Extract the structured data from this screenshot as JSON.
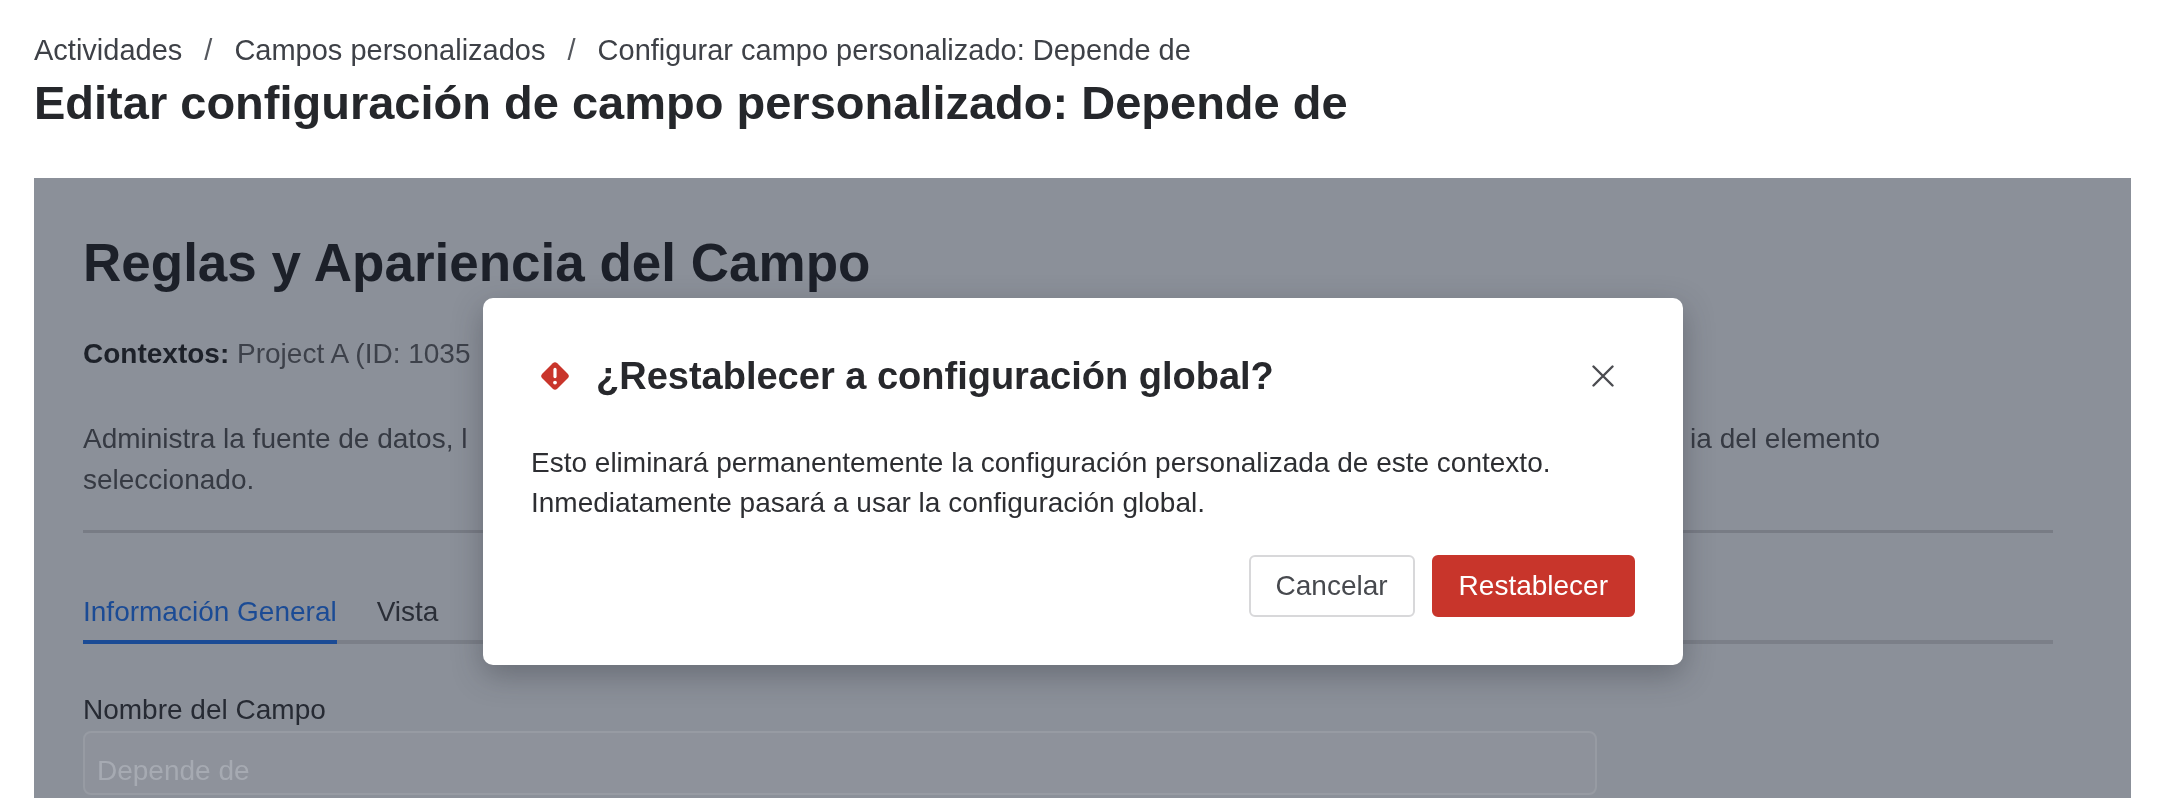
{
  "breadcrumb": [
    {
      "label": "Actividades"
    },
    {
      "separator": "/",
      "label": "Campos personalizados"
    },
    {
      "separator": "/",
      "label": "Configurar campo personalizado: Depende de"
    }
  ],
  "page_title": "Editar configuración de campo personalizado: Depende de",
  "card": {
    "title": "Reglas y Apariencia del Campo",
    "contexts": "**Contextos:** Project A (ID: 1035",
    "description": {
      "line_1_start": "Administra la fuente de datos, l",
      "line_1_end": "ia del elemento",
      "line_2": "seleccionado."
    },
    "tabs": [
      {
        "label": "Información General",
        "selected": true
      },
      {
        "label": "Vista",
        "selected": false
      }
    ],
    "field": {
      "label": "Nombre del Campo",
      "value": "Depende de",
      "disabled": true
    }
  },
  "dialog": {
    "title": "¿Restablecer a configuración global?",
    "message": "Esto eliminará permanentemente la configuración personalizada de este contexto. Inmediatamente pasará a usar la configuración global.",
    "buttons": [
      {
        "label": "Cancelar",
        "kind": "secondary"
      },
      {
        "label": "Restablecer",
        "kind": "danger"
      }
    ]
  }
}
